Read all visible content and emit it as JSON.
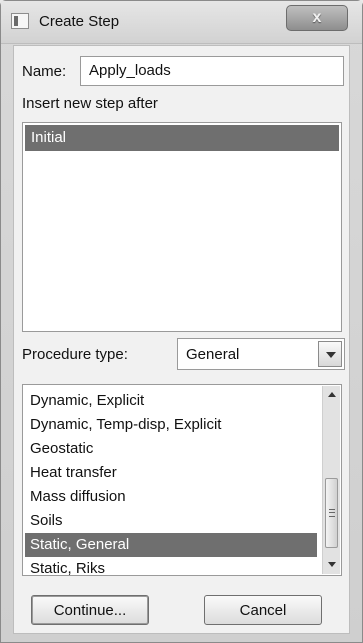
{
  "window": {
    "title": "Create Step",
    "close_label": "x"
  },
  "name_field": {
    "label": "Name:",
    "value": "Apply_loads"
  },
  "insert_after": {
    "label": "Insert new step after",
    "items": [
      "Initial"
    ],
    "selected": "Initial"
  },
  "procedure": {
    "label": "Procedure type:",
    "selected_value": "General",
    "list_items": [
      "Dynamic, Explicit",
      "Dynamic, Temp-disp, Explicit",
      "Geostatic",
      "Heat transfer",
      "Mass diffusion",
      "Soils",
      "Static, General",
      "Static, Riks"
    ],
    "selected_item": "Static, General"
  },
  "buttons": {
    "continue": "Continue...",
    "cancel": "Cancel"
  },
  "icons": {
    "app": "dialog-icon",
    "close": "close-icon",
    "dropdown": "chevron-down-icon",
    "scroll_up": "arrow-up-icon",
    "scroll_down": "arrow-down-icon",
    "grip": "grip-icon"
  }
}
